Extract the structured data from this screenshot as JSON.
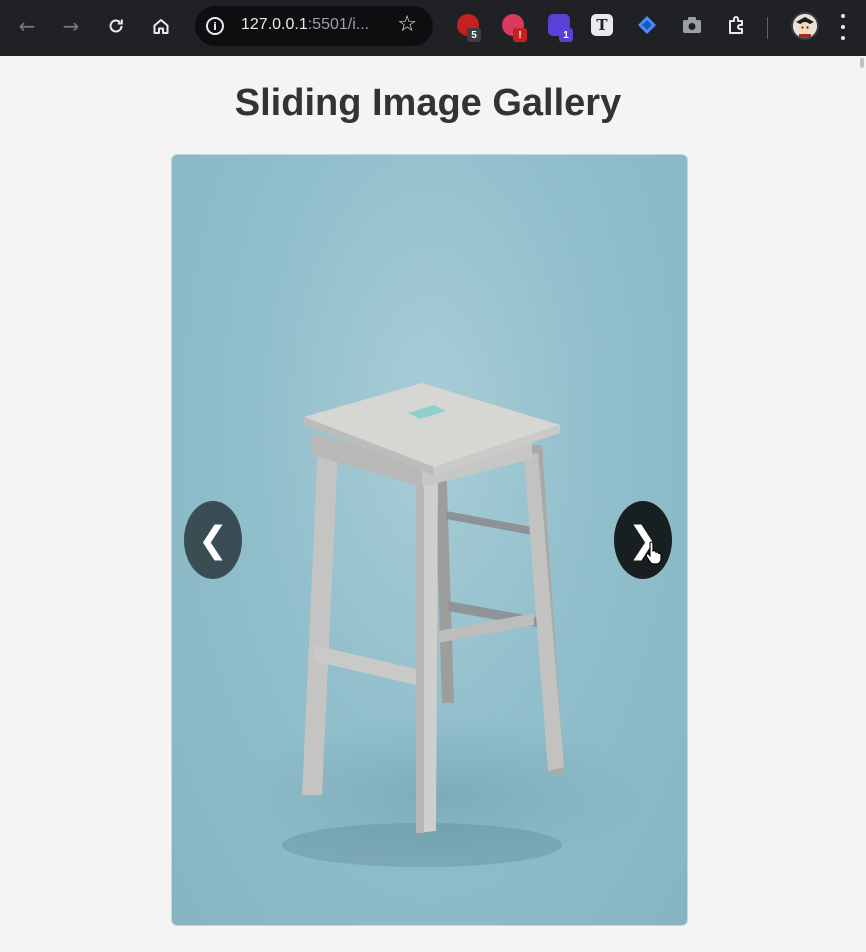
{
  "browser": {
    "url_host": "127.0.0.1",
    "url_rest": ":5501/i...",
    "extensions": [
      {
        "name": "extension-1",
        "badge": "5",
        "badge_color": "#3c4043",
        "color": "#c5221f"
      },
      {
        "name": "extension-2",
        "badge": "!",
        "badge_color": "#c5221f",
        "color": "#d93a5f"
      },
      {
        "name": "extension-3",
        "badge": "1",
        "badge_color": "#5b3fd6",
        "color": "#5b3fd6"
      },
      {
        "name": "extension-4",
        "badge": "",
        "badge_color": "",
        "color": "#e8eaed"
      },
      {
        "name": "extension-5",
        "badge": "",
        "badge_color": "",
        "color": "#4a8cf7"
      },
      {
        "name": "extension-6",
        "badge": "",
        "badge_color": "",
        "color": "#9aa0a6"
      }
    ]
  },
  "page": {
    "title": "Sliding Image Gallery",
    "prev_label": "❮",
    "next_label": "❯",
    "slide_image": "wooden-bar-stool"
  }
}
